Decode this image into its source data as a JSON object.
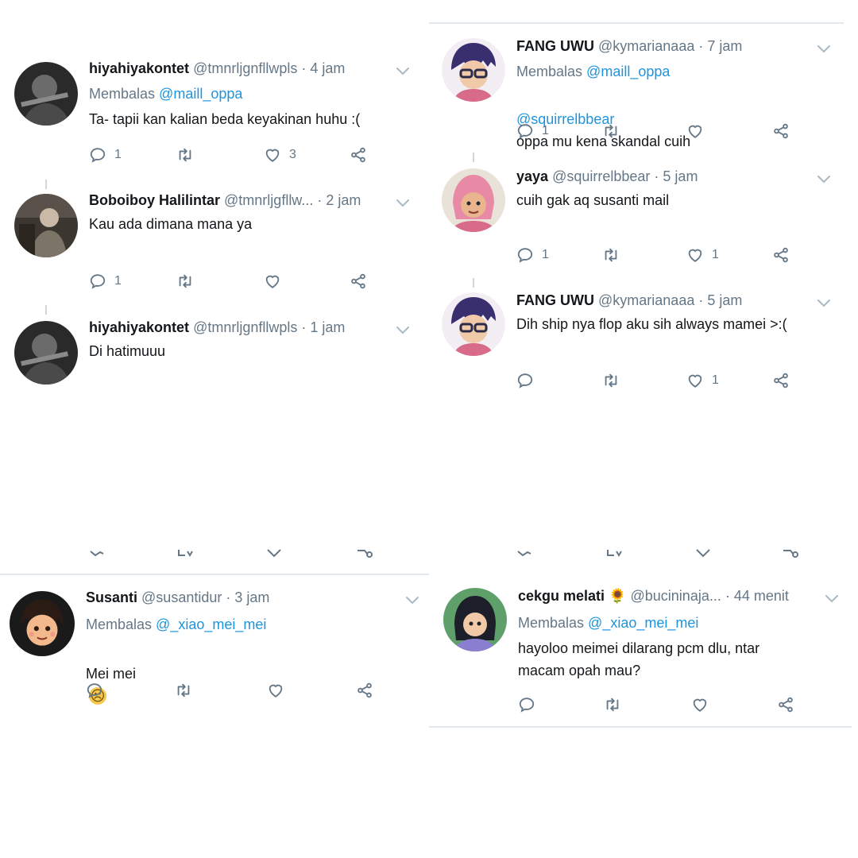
{
  "panels": {
    "top_left": [
      {
        "name": "hiyahiyakontet",
        "handle": "@tmnrljgnfllwpls",
        "sep": "·",
        "time": "4 jam",
        "reply_prefix": "Membalas",
        "reply_to": "@maill_oppa",
        "text": "Ta- tapii kan kalian beda keyakinan huhu :(",
        "counts": {
          "reply": "1",
          "retweet": "",
          "like": "3"
        }
      },
      {
        "name": "Boboiboy Halilintar",
        "handle": "@tmnrljgfllw...",
        "sep": "·",
        "time": "2 jam",
        "text": "Kau ada dimana mana ya",
        "counts": {
          "reply": "1",
          "retweet": "",
          "like": ""
        }
      },
      {
        "name": "hiyahiyakontet",
        "handle": "@tmnrljgnfllwpls",
        "sep": "·",
        "time": "1 jam",
        "text": "Di hatimuuu"
      }
    ],
    "top_right": [
      {
        "name": "FANG UWU",
        "handle": "@kymarianaaa",
        "sep": "·",
        "time": "7 jam",
        "reply_prefix": "Membalas",
        "reply_to": "@maill_oppa",
        "mention": "@squirrelbbear",
        "text": "oppa mu kena skandal cuih",
        "counts": {
          "reply": "1",
          "retweet": "",
          "like": ""
        }
      },
      {
        "name": "yaya",
        "handle": "@squirrelbbear",
        "sep": "·",
        "time": "5 jam",
        "text": "cuih gak aq susanti mail",
        "counts": {
          "reply": "1",
          "retweet": "",
          "like": "1"
        }
      },
      {
        "name": "FANG UWU",
        "handle": "@kymarianaaa",
        "sep": "·",
        "time": "5 jam",
        "text": "Dih ship nya flop aku sih always mamei >:(",
        "counts": {
          "reply": "",
          "retweet": "",
          "like": "1"
        }
      }
    ],
    "bottom_left": {
      "name": "Susanti",
      "handle": "@susantidur",
      "sep": "·",
      "time": "3 jam",
      "reply_prefix": "Membalas",
      "reply_to": "@_xiao_mei_mei",
      "text": "Mei mei",
      "emoji": "☹"
    },
    "bottom_right": {
      "name": "cekgu melati",
      "name_emoji": "🌻",
      "handle": "@bucininaja...",
      "sep": "·",
      "time": "44 menit",
      "reply_prefix": "Membalas",
      "reply_to": "@_xiao_mei_mei",
      "text": "hayoloo meimei dilarang pcm dlu, ntar\nmacam opah mau?"
    }
  },
  "icons": [
    "reply-icon",
    "retweet-icon",
    "like-icon",
    "share-icon",
    "chevron-down-icon"
  ],
  "colors": {
    "name": "#14171a",
    "muted": "#657786",
    "mention": "#1b95e0",
    "divider": "#e1e8ed"
  }
}
